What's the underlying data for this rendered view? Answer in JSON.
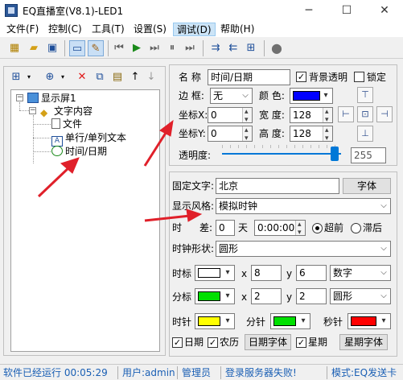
{
  "window": {
    "title": "EQ直播室(V8.1)-LED1"
  },
  "menubar": {
    "items": [
      "文件(F)",
      "控制(C)",
      "工具(T)",
      "设置(S)",
      "调试(D)",
      "帮助(H)"
    ]
  },
  "tree": {
    "root": "显示屏1",
    "group": "文字内容",
    "children": [
      "文件",
      "单行/单列文本",
      "时间/日期"
    ]
  },
  "props": {
    "name_label": "名 称",
    "name_value": "时间/日期",
    "bg_transparent_label": "背景透明",
    "lock_label": "锁定",
    "border_label": "边 框:",
    "border_value": "无",
    "color_label": "颜 色:",
    "color_value": "#0000ff",
    "x_label": "坐标X:",
    "x_value": "0",
    "width_label": "宽 度:",
    "width_value": "128",
    "y_label": "坐标Y:",
    "y_value": "0",
    "height_label": "高 度:",
    "height_value": "128",
    "opacity_label": "透明度:",
    "opacity_value": "255",
    "opacity_fraction": 1.0
  },
  "clock": {
    "fixed_text_label": "固定文字:",
    "fixed_text_value": "北京",
    "font_button": "字体",
    "style_label": "显示风格:",
    "style_value": "模拟时钟",
    "time_label": "时",
    "diff_label": "差:",
    "diff_days": "0",
    "days_unit": "天",
    "diff_time": "0:00:00",
    "ahead_label": "超前",
    "behind_label": "滞后",
    "shape_label": "时钟形状:",
    "shape_value": "圆形",
    "hour_mark": {
      "label": "时标",
      "color": "#ffffff",
      "x": "8",
      "y": "6",
      "style": "数字"
    },
    "min_mark": {
      "label": "分标",
      "color": "#00e000",
      "x": "2",
      "y": "2",
      "style": "圆形"
    },
    "hour_hand": {
      "label": "时针",
      "color": "#ffff00"
    },
    "minute_hand": {
      "label": "分针",
      "color": "#00e000"
    },
    "second_hand": {
      "label": "秒针",
      "color": "#ff0000"
    },
    "date_label": "日期",
    "lunar_label": "农历",
    "date_font_button": "日期字体",
    "week_label": "星期",
    "week_font_button": "星期字体"
  },
  "statusbar": {
    "run": "软件已经运行 00:05:29",
    "user": "用户:admin",
    "role": "管理员",
    "server": "登录服务器失败!",
    "mode": "模式:EQ发送卡"
  },
  "colors": {
    "arrow": "#e0202a",
    "accent": "#0078d7"
  }
}
